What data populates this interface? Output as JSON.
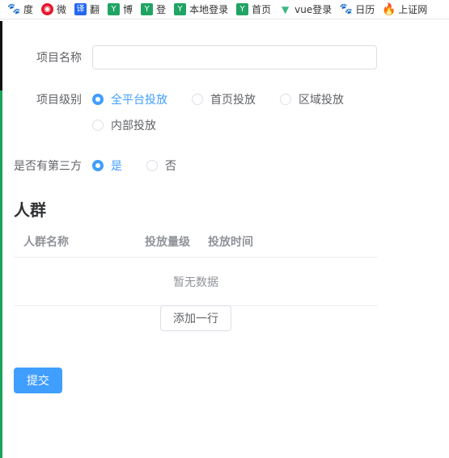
{
  "bookmarks": [
    {
      "icon": "baidu-paw-icon",
      "label": "度"
    },
    {
      "icon": "weibo-icon",
      "label": "微"
    },
    {
      "icon": "translate-icon",
      "label": "翻"
    },
    {
      "icon": "green-y-icon",
      "label": "博"
    },
    {
      "icon": "green-y-icon",
      "label": "登"
    },
    {
      "icon": "green-y-icon",
      "label": "本地登录"
    },
    {
      "icon": "green-y-icon",
      "label": "首页"
    },
    {
      "icon": "vue-icon",
      "label": "vue登录"
    },
    {
      "icon": "baidu-paw-icon",
      "label": "日历"
    },
    {
      "icon": "fire-icon",
      "label": "上证网"
    }
  ],
  "form": {
    "project_name": {
      "label": "项目名称",
      "value": "",
      "placeholder": ""
    },
    "project_level": {
      "label": "项目级别",
      "options": [
        "全平台投放",
        "首页投放",
        "区域投放",
        "内部投放"
      ],
      "selected": "全平台投放"
    },
    "third_party": {
      "label": "是否有第三方",
      "options": [
        "是",
        "否"
      ],
      "selected": "是"
    }
  },
  "crowd": {
    "title": "人群",
    "columns": [
      "人群名称",
      "投放量级",
      "投放时间"
    ],
    "rows": [],
    "empty_text": "暂无数据",
    "add_row_label": "添加一行"
  },
  "submit_label": "提交",
  "colors": {
    "primary": "#409eff",
    "text": "#606266",
    "header_text": "#909399",
    "border": "#dcdfe6"
  }
}
